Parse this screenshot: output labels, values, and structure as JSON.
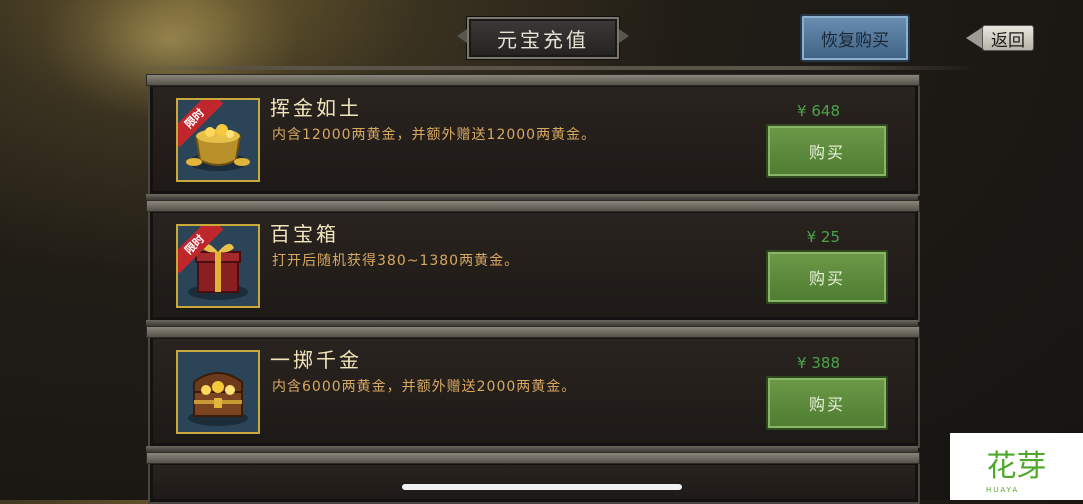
{
  "header": {
    "title": "元宝充值",
    "restore_label": "恢复购买",
    "back_label": "返回"
  },
  "items": [
    {
      "badge": "限时",
      "title": "挥金如土",
      "desc": "内含12000两黄金，并额外赠送12000两黄金。",
      "price": "¥ 648",
      "buy_label": "购买",
      "icon": "gold-pot-icon"
    },
    {
      "badge": "限时",
      "title": "百宝箱",
      "desc": "打开后随机获得380~1380两黄金。",
      "price": "¥ 25",
      "buy_label": "购买",
      "icon": "gift-box-icon"
    },
    {
      "badge": "",
      "title": "一掷千金",
      "desc": "内含6000两黄金，并额外赠送2000两黄金。",
      "price": "¥ 388",
      "buy_label": "购买",
      "icon": "treasure-chest-icon"
    }
  ],
  "watermark": {
    "text": "花芽",
    "sub": "HUAYA"
  },
  "colors": {
    "price_green": "#4ba34b",
    "buy_green": "#5f8c3d",
    "restore_blue": "#4f7396",
    "gold_border": "#c9a93c"
  }
}
